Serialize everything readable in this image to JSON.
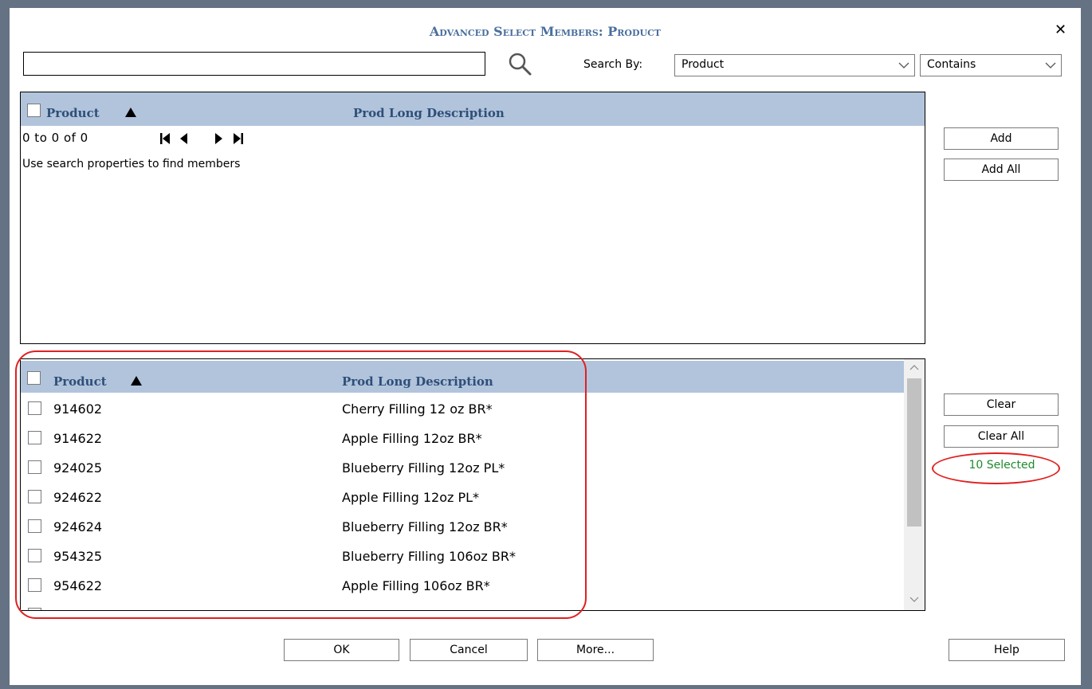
{
  "dialog": {
    "title": "Advanced Select Members: Product",
    "close_label": "✕"
  },
  "search": {
    "value": "",
    "placeholder": "",
    "by_label": "Search By:",
    "by_value": "Product",
    "match_value": "Contains"
  },
  "available_panel": {
    "col_product": "Product",
    "col_description": "Prod Long Description",
    "pager_text": "0 to 0 of 0",
    "hint": "Use search properties to find members"
  },
  "selected_panel": {
    "col_product": "Product",
    "col_description": "Prod Long Description",
    "rows": [
      {
        "code": "914602",
        "description": "Cherry Filling 12 oz BR*"
      },
      {
        "code": "914622",
        "description": "Apple Filling 12oz BR*"
      },
      {
        "code": "924025",
        "description": "Blueberry Filling 12oz PL*"
      },
      {
        "code": "924622",
        "description": "Apple Filling 12oz PL*"
      },
      {
        "code": "924624",
        "description": "Blueberry Filling 12oz BR*"
      },
      {
        "code": "954325",
        "description": "Blueberry Filling 106oz BR*"
      },
      {
        "code": "954622",
        "description": "Apple Filling 106oz BR*"
      }
    ]
  },
  "side": {
    "add": "Add",
    "add_all": "Add All",
    "clear": "Clear",
    "clear_all": "Clear All",
    "selected_count": "10 Selected"
  },
  "footer": {
    "ok": "OK",
    "cancel": "Cancel",
    "more": "More...",
    "help": "Help"
  },
  "colors": {
    "header_bg": "#b1c4dc",
    "title": "#4a6f9e",
    "selected_text": "#1e8a2e",
    "highlight": "#e02020",
    "backdrop": "#657284"
  }
}
